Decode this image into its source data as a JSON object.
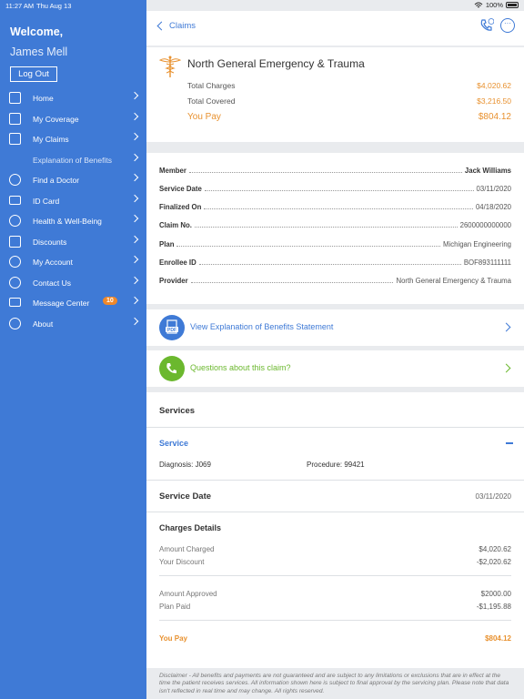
{
  "status_bar": {
    "time": "11:27 AM",
    "date": "Thu Aug 13",
    "battery": "100%"
  },
  "sidebar": {
    "welcome": "Welcome,",
    "user_name": "James Mell",
    "logout_label": "Log Out",
    "items": [
      {
        "label": "Home",
        "icon": "home-icon"
      },
      {
        "label": "My Coverage",
        "icon": "shield-icon"
      },
      {
        "label": "My Claims",
        "icon": "claims-icon"
      },
      {
        "label": "Explanation of Benefits",
        "icon": ""
      },
      {
        "label": "Find a Doctor",
        "icon": "doctor-icon"
      },
      {
        "label": "ID Card",
        "icon": "id-card-icon"
      },
      {
        "label": "Health & Well-Being",
        "icon": "heart-icon"
      },
      {
        "label": "Discounts",
        "icon": "discount-icon"
      },
      {
        "label": "My Account",
        "icon": "gear-icon"
      },
      {
        "label": "Contact Us",
        "icon": "phone-icon"
      },
      {
        "label": "Message Center",
        "icon": "mail-icon",
        "badge": "10"
      },
      {
        "label": "About",
        "icon": "info-icon"
      }
    ]
  },
  "header": {
    "back_label": "Claims"
  },
  "summary": {
    "provider": "North General Emergency & Trauma",
    "total_charges_label": "Total Charges",
    "total_charges": "$4,020.62",
    "total_covered_label": "Total Covered",
    "total_covered": "$3,216.50",
    "you_pay_label": "You Pay",
    "you_pay": "$804.12"
  },
  "details": [
    {
      "label": "Member",
      "value": "Jack Williams"
    },
    {
      "label": "Service Date",
      "value": "03/11/2020"
    },
    {
      "label": "Finalized On",
      "value": "04/18/2020"
    },
    {
      "label": "Claim No.",
      "value": "2600000000000"
    },
    {
      "label": "Plan",
      "value": "Michigan Engineering"
    },
    {
      "label": "Enrollee ID",
      "value": "BOF893111111"
    },
    {
      "label": "Provider",
      "value": "North General Emergency & Trauma"
    }
  ],
  "actions": {
    "eob_label": "View Explanation of Benefits Statement",
    "pdf_badge": "PDF",
    "questions_label": "Questions about this claim?"
  },
  "services": {
    "heading": "Services",
    "service_title": "Service",
    "diagnosis": "Diagnosis: J069",
    "procedure": "Procedure: 99421",
    "service_date_label": "Service Date",
    "service_date": "03/11/2020",
    "charges_title": "Charges Details",
    "amount_charged_label": "Amount Charged",
    "amount_charged": "$4,020.62",
    "discount_label": "Your Discount",
    "discount": "-$2,020.62",
    "amount_approved_label": "Amount Approved",
    "amount_approved": "$2000.00",
    "plan_paid_label": "Plan Paid",
    "plan_paid": "-$1,195.88",
    "you_pay_label": "You Pay",
    "you_pay": "$804.12"
  },
  "disclaimer": "Disclaimer - All benefits and payments are not guaranteed and are subject to any limitations or exclusions that are in effect at the time the patient receives services. All information shown here is subject to final approval by the servicing plan. Please note that data isn't reflected in real time and may change. All rights reserved.",
  "colors": {
    "brand_blue": "#3f7ad6",
    "accent_orange": "#e8912f",
    "green": "#6bb82e"
  }
}
